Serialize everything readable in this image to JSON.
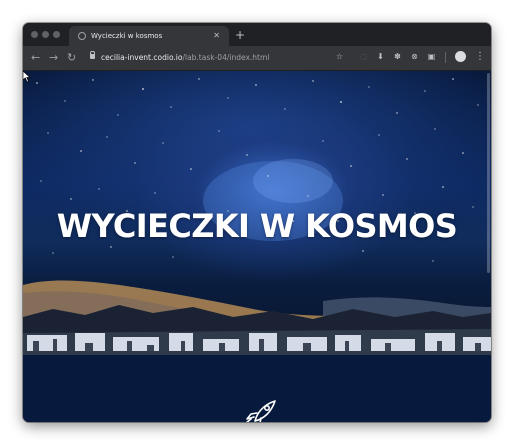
{
  "browser": {
    "tab": {
      "title": "Wycieczki w kosmos",
      "close": "✕"
    },
    "new_tab": "+",
    "nav": {
      "back": "←",
      "forward": "→",
      "reload": "↻"
    },
    "url": {
      "host": "cecilia-invent.codio.io",
      "path": "/lab.task-04/index.html"
    },
    "toolbar_icons": [
      "bookmark-star-icon",
      "extension-icon",
      "download-icon",
      "extension-icon",
      "extension-icon",
      "extension-icon",
      "profile-avatar-icon",
      "menu-icon"
    ],
    "menu": "⋮"
  },
  "page": {
    "hero": {
      "title": "WYCIECZKI W KOSMOS"
    },
    "section_icon": "rocket-icon"
  },
  "colors": {
    "chrome_dark": "#202124",
    "toolbar": "#35363a",
    "section_bg": "#07193d",
    "hero_title": "#ffffff"
  }
}
